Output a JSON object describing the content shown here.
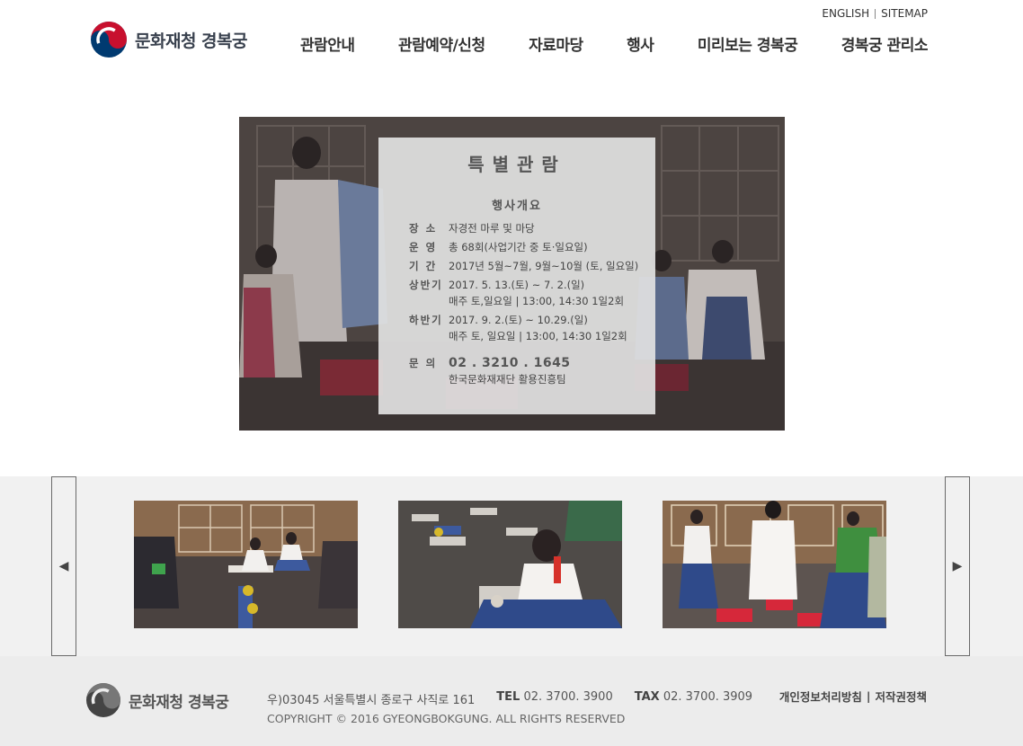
{
  "header": {
    "logo_text": "문화재청 경복궁",
    "top_links": [
      "ENGLISH",
      "SITEMAP"
    ],
    "nav": [
      "관람안내",
      "관람예약/신청",
      "자료마당",
      "행사",
      "미리보는 경복궁",
      "경복궁 관리소"
    ]
  },
  "hero": {
    "title": "특별관람",
    "subtitle": "행사개요",
    "rows": [
      {
        "key": "장  소",
        "value": "자경전 마루 및 마당"
      },
      {
        "key": "운  영",
        "value": "총 68회(사업기간 중 토·일요일)"
      },
      {
        "key": "기  간",
        "value": "2017년 5월~7월, 9월~10월 (토, 일요일)"
      },
      {
        "key": "상반기",
        "value": "2017. 5. 13.(토) ~ 7. 2.(일)",
        "value2": "매주 토,일요일 | 13:00, 14:30 1일2회"
      },
      {
        "key": "하반기",
        "value": "2017. 9. 2.(토) ~ 10.29.(일)",
        "value2": "매주 토, 일요일 | 13:00, 14:30 1일2회"
      }
    ],
    "contact": {
      "key": "문  의",
      "phone": "02 . 3210 . 1645",
      "org": "한국문화재재단 활용진흥팀"
    }
  },
  "gallery": {
    "prev_icon": "◀",
    "next_icon": "▶"
  },
  "footer": {
    "logo_text": "문화재청 경복궁",
    "address": "우)03045 서울특별시 종로구 사직로 161",
    "tel_label": "TEL",
    "tel": "02. 3700. 3900",
    "fax_label": "TAX",
    "fax": "02. 3700. 3909",
    "copyright": "COPYRIGHT © 2016 GYEONGBOKGUNG. ALL RIGHTS RESERVED",
    "links": [
      "개인정보처리방침",
      "저작권정책"
    ]
  },
  "colors": {
    "emblem_red": "#c8102e",
    "emblem_blue": "#003a70",
    "footer_bg": "#ececec",
    "gallery_bg": "#f1f1f1"
  }
}
